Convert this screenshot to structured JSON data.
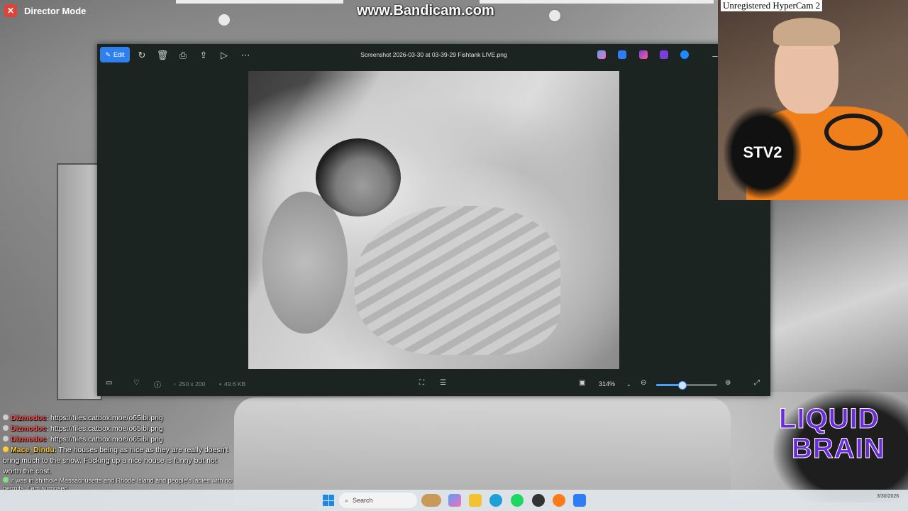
{
  "overlay": {
    "director_mode_label": "Director Mode",
    "watermark": "www.Bandicam.com",
    "webcam_label": "Unregistered HyperCam 2",
    "webcam_badge": "STV2",
    "logo_line1": "LIQUID",
    "logo_line2": "BRAIN"
  },
  "viewer": {
    "edit_label": "Edit",
    "filename": "Screenshot 2026-03-30 at 03-39-29 Fishtank LIVE.png",
    "dimensions": "250 x 200",
    "file_size": "49.6 KB",
    "zoom_level": "314%",
    "zoom_fraction": 0.42
  },
  "chat": {
    "messages": [
      {
        "user": "Dizmodoc",
        "text": "https://files.catbox.moe/o65ibi.png"
      },
      {
        "user": "Dizmodoc",
        "text": "https://files.catbox.moe/o65ibi.png"
      },
      {
        "user": "Dizmodoc",
        "text": "https://files.catbox.moe/o65ibi.png"
      },
      {
        "user": "Mace_Dindu",
        "text": "The houses being as nice as they are really doesn't bring much to the show. Fucking up a nice house is funny but not worth the cost."
      },
      {
        "user": "",
        "text": "it was in shithole Massachusetts and Rhode Island and people's ladies with no permits. I am surprised"
      }
    ]
  },
  "taskbar": {
    "search_placeholder": "Search",
    "clock": "3/30/2026"
  }
}
